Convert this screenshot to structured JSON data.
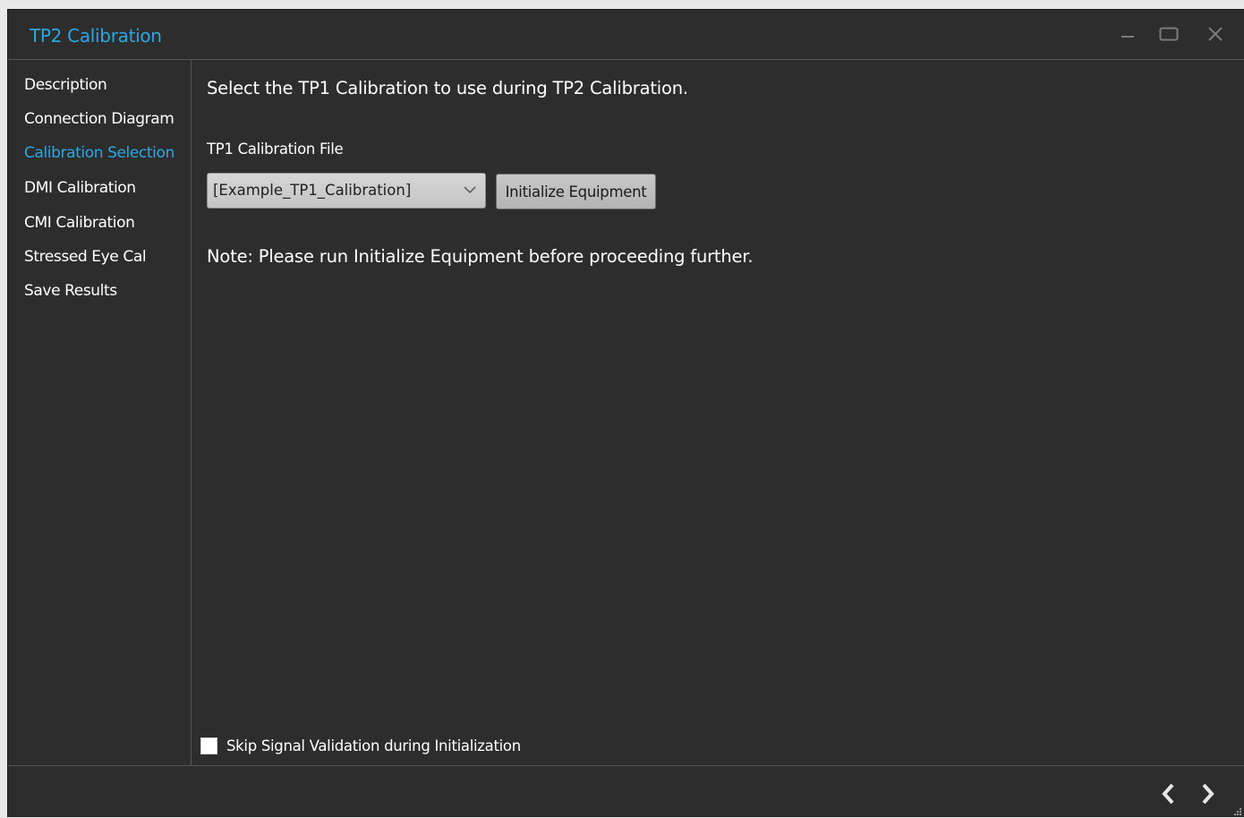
{
  "window": {
    "title": "TP2 Calibration",
    "accent_color": "#29a9e0",
    "controls": [
      "minimize-icon",
      "maximize-icon",
      "close-icon"
    ]
  },
  "sidebar": {
    "items": [
      {
        "label": "Description",
        "active": false
      },
      {
        "label": "Connection Diagram",
        "active": false
      },
      {
        "label": "Calibration Selection",
        "active": true
      },
      {
        "label": "DMI Calibration",
        "active": false
      },
      {
        "label": "CMI Calibration",
        "active": false
      },
      {
        "label": "Stressed Eye Cal",
        "active": false
      },
      {
        "label": "Save Results",
        "active": false
      }
    ]
  },
  "main": {
    "instruction": "Select the TP1 Calibration to use during TP2 Calibration.",
    "field_label": "TP1 Calibration File",
    "calibration_file": {
      "selected": "[Example_TP1_Calibration]"
    },
    "initialize_button_label": "Initialize Equipment",
    "note": "Note: Please run Initialize Equipment before proceeding further.",
    "skip_validation": {
      "label": "Skip Signal Validation during Initialization",
      "checked": false
    }
  },
  "footer": {
    "back_icon": "chevron-left-icon",
    "next_icon": "chevron-right-icon"
  }
}
